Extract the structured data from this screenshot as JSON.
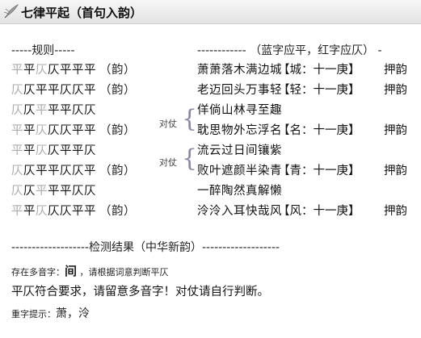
{
  "title": "七律平起（首句入韵）",
  "rules_header": "-----规则-----",
  "right_header": "------------ （蓝字应平，红字应仄） -",
  "yun_label": "（韵）",
  "yayun_label": "押韵",
  "duizhang_label": "对仗",
  "rows": [
    {
      "pattern": [
        [
          "平",
          "e"
        ],
        [
          "平",
          "p"
        ],
        [
          "仄",
          "e"
        ],
        [
          "仄",
          "z"
        ],
        [
          "平",
          "p"
        ],
        [
          "平",
          "p"
        ],
        [
          "平",
          "p"
        ]
      ],
      "yun": true,
      "verse": "萧萧落木满边城",
      "rhyme": "【城：十一庚】",
      "yayun": true
    },
    {
      "pattern": [
        [
          "仄",
          "e"
        ],
        [
          "仄",
          "z"
        ],
        [
          "平",
          "p"
        ],
        [
          "平",
          "p"
        ],
        [
          "仄",
          "z"
        ],
        [
          "仄",
          "z"
        ],
        [
          "平",
          "p"
        ]
      ],
      "yun": true,
      "verse": "老迈回头万事轻",
      "rhyme": "【轻：十一庚】",
      "yayun": true
    },
    {
      "pattern": [
        [
          "仄",
          "e"
        ],
        [
          "仄",
          "z"
        ],
        [
          "平",
          "e"
        ],
        [
          "平",
          "p"
        ],
        [
          "平",
          "p"
        ],
        [
          "仄",
          "z"
        ],
        [
          "仄",
          "z"
        ]
      ],
      "yun": false,
      "verse": "佯倘山林寻至趣",
      "rhyme": "",
      "yayun": false
    },
    {
      "pattern": [
        [
          "平",
          "e"
        ],
        [
          "平",
          "p"
        ],
        [
          "仄",
          "e"
        ],
        [
          "仄",
          "z"
        ],
        [
          "仄",
          "z"
        ],
        [
          "平",
          "p"
        ],
        [
          "平",
          "p"
        ]
      ],
      "yun": true,
      "verse": "耽思物外忘浮名",
      "rhyme": "【名：十一庚】",
      "yayun": true
    },
    {
      "pattern": [
        [
          "平",
          "e"
        ],
        [
          "平",
          "p"
        ],
        [
          "仄",
          "e"
        ],
        [
          "仄",
          "z"
        ],
        [
          "平",
          "p"
        ],
        [
          "平",
          "p"
        ],
        [
          "仄",
          "z"
        ]
      ],
      "yun": false,
      "verse": "流云过日间镶紫",
      "rhyme": "",
      "yayun": false
    },
    {
      "pattern": [
        [
          "仄",
          "e"
        ],
        [
          "仄",
          "z"
        ],
        [
          "平",
          "p"
        ],
        [
          "平",
          "p"
        ],
        [
          "仄",
          "z"
        ],
        [
          "仄",
          "z"
        ],
        [
          "平",
          "p"
        ]
      ],
      "yun": true,
      "verse": "败叶遮颜半染青",
      "rhyme": "【青：十一庚】",
      "yayun": true
    },
    {
      "pattern": [
        [
          "仄",
          "e"
        ],
        [
          "仄",
          "z"
        ],
        [
          "平",
          "e"
        ],
        [
          "平",
          "p"
        ],
        [
          "平",
          "p"
        ],
        [
          "仄",
          "z"
        ],
        [
          "仄",
          "z"
        ]
      ],
      "yun": false,
      "verse": "一醉陶然真解懒",
      "rhyme": "",
      "yayun": false
    },
    {
      "pattern": [
        [
          "平",
          "e"
        ],
        [
          "平",
          "p"
        ],
        [
          "仄",
          "e"
        ],
        [
          "仄",
          "z"
        ],
        [
          "仄",
          "z"
        ],
        [
          "平",
          "p"
        ],
        [
          "平",
          "p"
        ]
      ],
      "yun": true,
      "verse": "泠泠入耳快哉风",
      "rhyme": "【风：十一庚】",
      "yayun": true
    }
  ],
  "result_header": "-------------------检测结果（中华新韵）-------------------",
  "polyphone": {
    "prefix": "存在多音字：",
    "chars": "间",
    "suffix": " ，请根据词意判断平仄"
  },
  "main_result": "平仄符合要求，请留意多音字！对仗请自行判断。",
  "repeat": {
    "prefix": "重字提示：",
    "chars": "萧，泠"
  }
}
